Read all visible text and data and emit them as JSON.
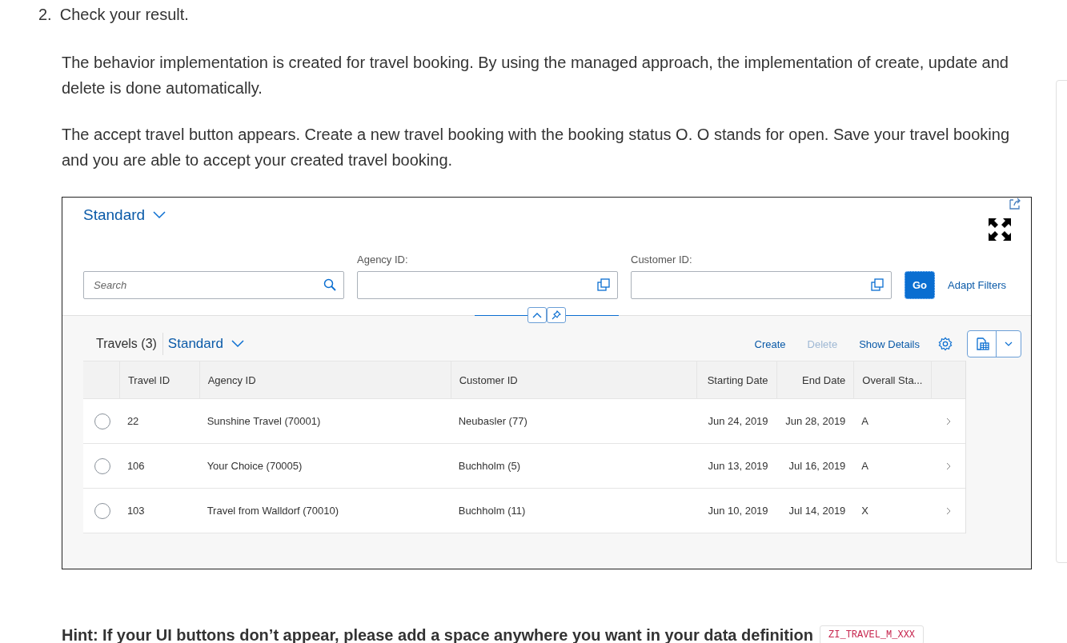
{
  "step": {
    "number": "2.",
    "title": "Check your result."
  },
  "paragraphs": [
    "The behavior implementation is created for travel booking. By using the managed approach, the implementation of create, update and delete is done automatically.",
    "The accept travel button appears. Create a new travel booking with the booking status O. O stands for open. Save your travel booking and you are able to accept your created travel booking."
  ],
  "app": {
    "variant": "Standard",
    "search": {
      "placeholder": "Search"
    },
    "filters": [
      {
        "label": "Agency ID:"
      },
      {
        "label": "Customer ID:"
      }
    ],
    "go": "Go",
    "adapt_filters": "Adapt Filters",
    "table": {
      "title": "Travels (3)",
      "variant": "Standard",
      "actions": [
        {
          "label": "Create",
          "disabled": false
        },
        {
          "label": "Delete",
          "disabled": true
        },
        {
          "label": "Show Details",
          "disabled": false
        }
      ],
      "columns": [
        "Travel ID",
        "Agency ID",
        "Customer ID",
        "Starting Date",
        "End Date",
        "Overall Sta..."
      ],
      "rows": [
        {
          "selected": false,
          "cells": [
            "22",
            "Sunshine Travel (70001)",
            "Neubasler (77)",
            "Jun 24, 2019",
            "Jun 28, 2019",
            "A"
          ]
        },
        {
          "selected": false,
          "cells": [
            "106",
            "Your Choice (70005)",
            "Buchholm (5)",
            "Jun 13, 2019",
            "Jul 16, 2019",
            "A"
          ]
        },
        {
          "selected": false,
          "cells": [
            "103",
            "Travel from Walldorf (70010)",
            "Buchholm (11)",
            "Jun 10, 2019",
            "Jul 14, 2019",
            "X"
          ]
        }
      ]
    }
  },
  "hint": {
    "text": "Hint: If your UI buttons don’t appear, please add a space anywhere you want in your data definition",
    "code": "ZI_TRAVEL_M_XXX"
  }
}
